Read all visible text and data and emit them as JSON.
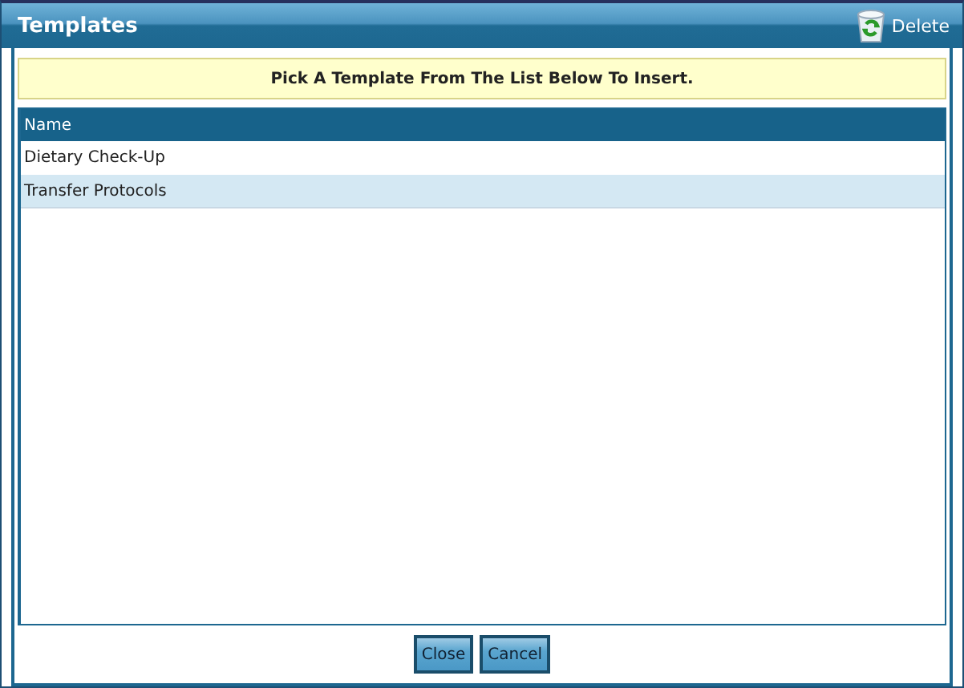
{
  "window": {
    "title": "Templates",
    "delete_label": "Delete"
  },
  "notice": "Pick A Template From The List Below To Insert.",
  "table": {
    "columns": [
      "Name"
    ],
    "rows": [
      {
        "name": "Dietary Check-Up",
        "selected": false
      },
      {
        "name": "Transfer Protocols",
        "selected": true
      }
    ]
  },
  "buttons": [
    "Close",
    "Cancel"
  ]
}
